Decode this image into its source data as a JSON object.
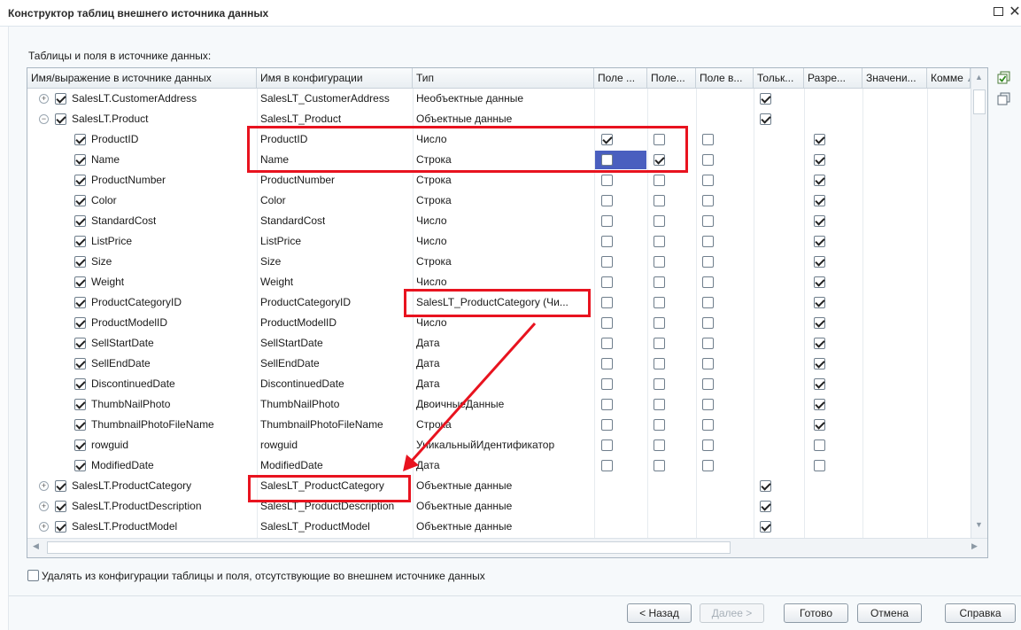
{
  "window": {
    "title": "Конструктор таблиц внешнего источника данных",
    "maximize_icon": "maximize-icon",
    "close_icon": "close-icon"
  },
  "section_label": "Таблицы и поля в источнике данных:",
  "columns": [
    "Имя/выражение в источнике данных",
    "Имя в конфигурации",
    "Тип",
    "Поле ...",
    "Поле...",
    "Поле в...",
    "Тольк...",
    "Разре...",
    "Значени...",
    "Комме"
  ],
  "rows": [
    {
      "expand": "+",
      "checked": true,
      "source": "SalesLT.CustomerAddress",
      "config": "SalesLT_CustomerAddress",
      "type": "Необъектные данные",
      "f1": null,
      "f2": null,
      "f3": null,
      "readonly": true,
      "allowed": null
    },
    {
      "expand": "−",
      "checked": true,
      "source": "SalesLT.Product",
      "config": "SalesLT_Product",
      "type": "Объектные данные",
      "f1": null,
      "f2": null,
      "f3": null,
      "readonly": true,
      "allowed": null
    },
    {
      "checked": true,
      "source": "ProductID",
      "config": "ProductID",
      "type": "Число",
      "f1": true,
      "f2": false,
      "f3": false,
      "readonly": null,
      "allowed": true
    },
    {
      "checked": true,
      "source": "Name",
      "config": "Name",
      "type": "Строка",
      "f1": false,
      "f2": true,
      "f3": false,
      "readonly": null,
      "allowed": true,
      "selected_f1": true
    },
    {
      "checked": true,
      "source": "ProductNumber",
      "config": "ProductNumber",
      "type": "Строка",
      "f1": false,
      "f2": false,
      "f3": false,
      "readonly": null,
      "allowed": true
    },
    {
      "checked": true,
      "source": "Color",
      "config": "Color",
      "type": "Строка",
      "f1": false,
      "f2": false,
      "f3": false,
      "readonly": null,
      "allowed": true
    },
    {
      "checked": true,
      "source": "StandardCost",
      "config": "StandardCost",
      "type": "Число",
      "f1": false,
      "f2": false,
      "f3": false,
      "readonly": null,
      "allowed": true
    },
    {
      "checked": true,
      "source": "ListPrice",
      "config": "ListPrice",
      "type": "Число",
      "f1": false,
      "f2": false,
      "f3": false,
      "readonly": null,
      "allowed": true
    },
    {
      "checked": true,
      "source": "Size",
      "config": "Size",
      "type": "Строка",
      "f1": false,
      "f2": false,
      "f3": false,
      "readonly": null,
      "allowed": true
    },
    {
      "checked": true,
      "source": "Weight",
      "config": "Weight",
      "type": "Число",
      "f1": false,
      "f2": false,
      "f3": false,
      "readonly": null,
      "allowed": true
    },
    {
      "checked": true,
      "source": "ProductCategoryID",
      "config": "ProductCategoryID",
      "type": "SalesLT_ProductCategory (Чи...",
      "f1": false,
      "f2": false,
      "f3": false,
      "readonly": null,
      "allowed": true
    },
    {
      "checked": true,
      "source": "ProductModelID",
      "config": "ProductModelID",
      "type": "Число",
      "f1": false,
      "f2": false,
      "f3": false,
      "readonly": null,
      "allowed": true
    },
    {
      "checked": true,
      "source": "SellStartDate",
      "config": "SellStartDate",
      "type": "Дата",
      "f1": false,
      "f2": false,
      "f3": false,
      "readonly": null,
      "allowed": true
    },
    {
      "checked": true,
      "source": "SellEndDate",
      "config": "SellEndDate",
      "type": "Дата",
      "f1": false,
      "f2": false,
      "f3": false,
      "readonly": null,
      "allowed": true
    },
    {
      "checked": true,
      "source": "DiscontinuedDate",
      "config": "DiscontinuedDate",
      "type": "Дата",
      "f1": false,
      "f2": false,
      "f3": false,
      "readonly": null,
      "allowed": true
    },
    {
      "checked": true,
      "source": "ThumbNailPhoto",
      "config": "ThumbNailPhoto",
      "type": "ДвоичныеДанные",
      "f1": false,
      "f2": false,
      "f3": false,
      "readonly": null,
      "allowed": true
    },
    {
      "checked": true,
      "source": "ThumbnailPhotoFileName",
      "config": "ThumbnailPhotoFileName",
      "type": "Строка",
      "f1": false,
      "f2": false,
      "f3": false,
      "readonly": null,
      "allowed": true
    },
    {
      "checked": true,
      "source": "rowguid",
      "config": "rowguid",
      "type": "УникальныйИдентификатор",
      "f1": false,
      "f2": false,
      "f3": false,
      "readonly": null,
      "allowed": false
    },
    {
      "checked": true,
      "source": "ModifiedDate",
      "config": "ModifiedDate",
      "type": "Дата",
      "f1": false,
      "f2": false,
      "f3": false,
      "readonly": null,
      "allowed": false
    },
    {
      "expand": "+",
      "checked": true,
      "source": "SalesLT.ProductCategory",
      "config": "SalesLT_ProductCategory",
      "type": "Объектные данные",
      "f1": null,
      "f2": null,
      "f3": null,
      "readonly": true,
      "allowed": null
    },
    {
      "expand": "+",
      "checked": true,
      "source": "SalesLT.ProductDescription",
      "config": "SalesLT_ProductDescription",
      "type": "Объектные данные",
      "f1": null,
      "f2": null,
      "f3": null,
      "readonly": true,
      "allowed": null
    },
    {
      "expand": "+",
      "checked": true,
      "source": "SalesLT.ProductModel",
      "config": "SalesLT_ProductModel",
      "type": "Объектные данные",
      "f1": null,
      "f2": null,
      "f3": null,
      "readonly": true,
      "allowed": null
    }
  ],
  "delete_option": {
    "checked": false,
    "label": "Удалять из конфигурации таблицы и поля, отсутствующие во внешнем источнике данных"
  },
  "buttons": {
    "back": "< Назад",
    "next": "Далее >",
    "done": "Готово",
    "cancel": "Отмена",
    "help": "Справка"
  },
  "side_icons": [
    "check-all-icon",
    "uncheck-all-icon"
  ],
  "colors": {
    "highlight_box": "#e8131f",
    "selection": "#4a5fbf"
  }
}
